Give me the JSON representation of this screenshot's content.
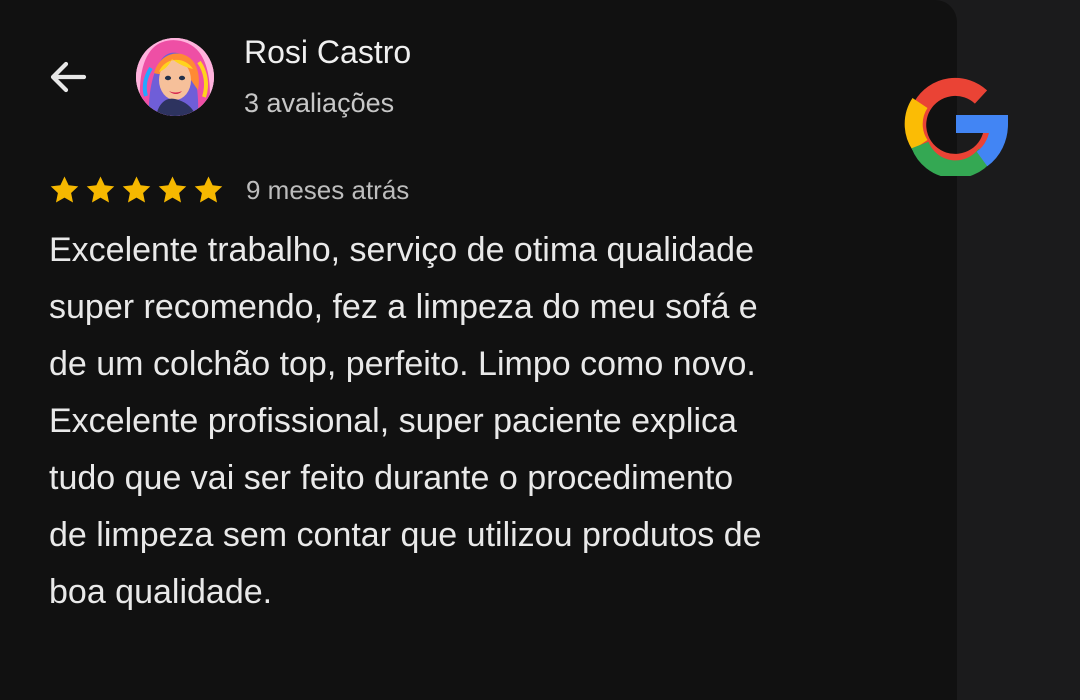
{
  "reviewer": {
    "name": "Rosi Castro",
    "review_count": "3 avaliações"
  },
  "rating": {
    "stars": 5,
    "max_stars": 5,
    "date": "9 meses atrás",
    "star_color": "#f6b800"
  },
  "review": {
    "text": "Excelente trabalho, serviço de otima qualidade\nsuper recomendo, fez a limpeza do meu sofá e\nde um colchão top, perfeito. Limpo como novo.\nExcelente profissional,  super paciente explica\ntudo que vai ser feito durante o procedimento\nde limpeza sem contar que utilizou produtos de\nboa qualidade."
  },
  "icons": {
    "back": "arrow-left-icon",
    "brand": "google-logo-icon",
    "rating": "star-icon"
  },
  "colors": {
    "background": "#111111",
    "text": "#e9e9e9",
    "muted_text": "#c7c7c7",
    "google_blue": "#4285f4",
    "google_red": "#ea4335",
    "google_yellow": "#fbbc05",
    "google_green": "#34a853"
  }
}
